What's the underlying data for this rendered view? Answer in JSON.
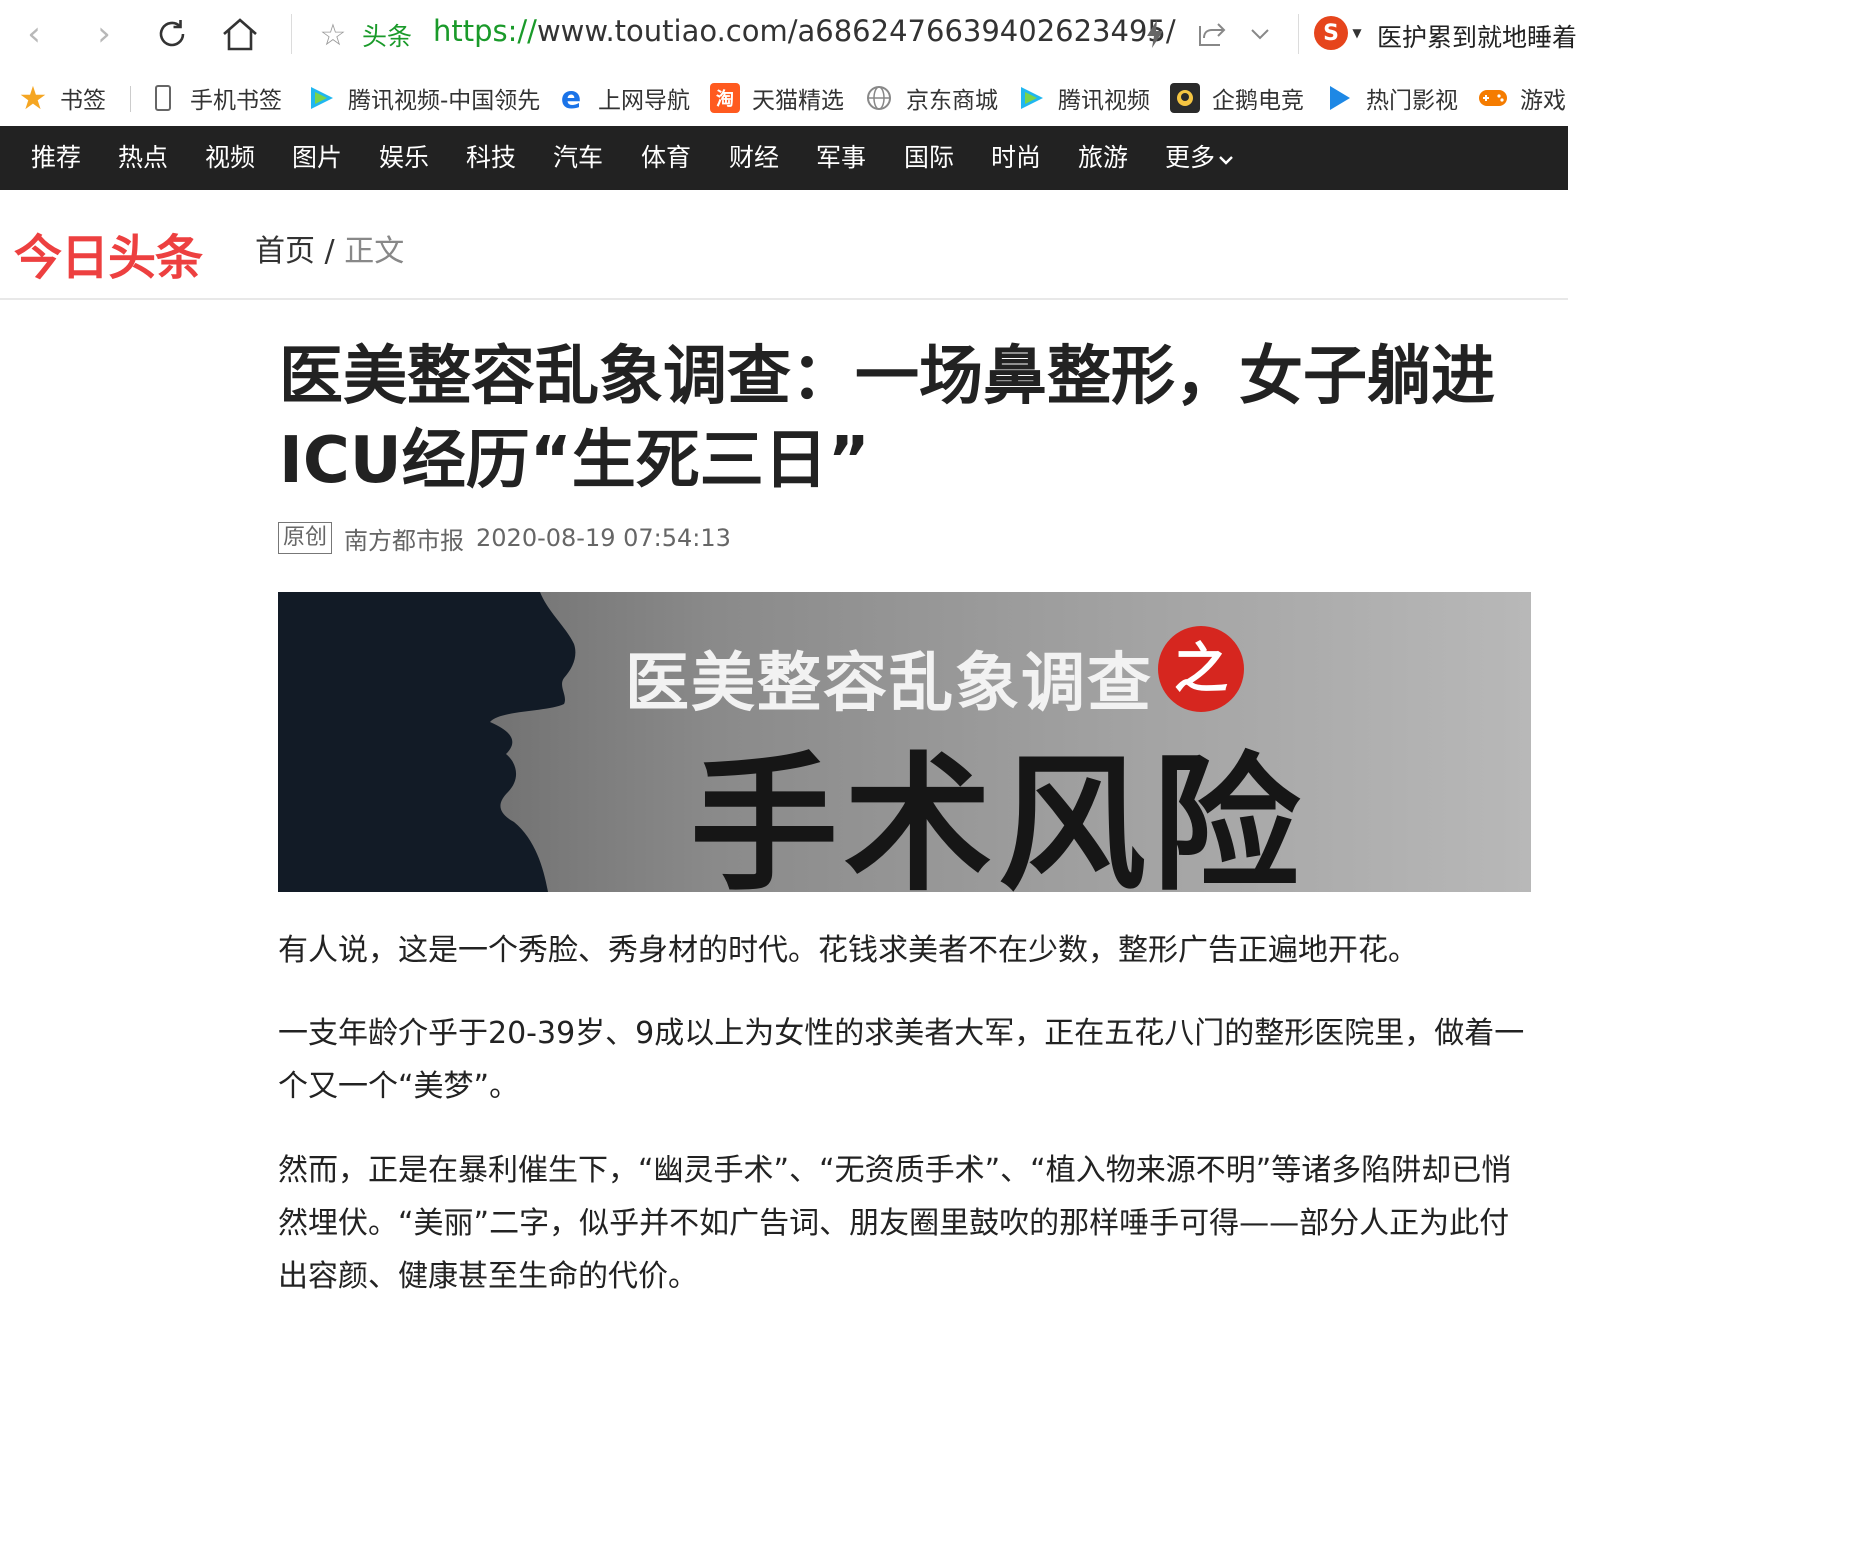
{
  "browser": {
    "site_name": "头条",
    "url_scheme": "https://",
    "url_rest": "www.toutiao.com/a6862476639402623495/",
    "search_engine_icon": "S",
    "search_text": "医护累到就地睡着"
  },
  "bookmarks": [
    {
      "label": "书签",
      "icon": "star-icon",
      "color": "#f5a623"
    },
    {
      "label": "手机书签",
      "icon": "phone-icon",
      "color": "#666666"
    },
    {
      "label": "腾讯视频-中国领先",
      "icon": "tencent-video-icon",
      "color": "#20b7f0"
    },
    {
      "label": "上网导航",
      "icon": "ie-icon",
      "color": "#1a73e8"
    },
    {
      "label": "天猫精选",
      "icon": "tmall-icon",
      "icon_text": "淘",
      "color": "#ff5a1f"
    },
    {
      "label": "京东商城",
      "icon": "globe-icon",
      "color": "#888888"
    },
    {
      "label": "腾讯视频",
      "icon": "tencent-video-icon",
      "color": "#20b7f0"
    },
    {
      "label": "企鹅电竞",
      "icon": "penguin-esports-icon",
      "color": "#2a2a2a"
    },
    {
      "label": "热门影视",
      "icon": "play-icon",
      "color": "#1e88e5"
    },
    {
      "label": "游戏",
      "icon": "gamepad-icon",
      "color": "#f57c00"
    }
  ],
  "channels": [
    "推荐",
    "热点",
    "视频",
    "图片",
    "娱乐",
    "科技",
    "汽车",
    "体育",
    "财经",
    "军事",
    "国际",
    "时尚",
    "旅游"
  ],
  "channel_more": "更多",
  "header": {
    "logo": "今日头条",
    "breadcrumb_home": "首页",
    "breadcrumb_sep": "/",
    "breadcrumb_current": "正文"
  },
  "article": {
    "title": "医美整容乱象调查：一场鼻整形，女子躺进ICU经历“生死三日”",
    "badge": "原创",
    "source": "南方都市报",
    "time": "2020-08-19 07:54:13",
    "banner_line1": "医美整容乱象调查",
    "banner_badge": "之",
    "banner_line2": "手术风险",
    "paragraphs": [
      "有人说，这是一个秀脸、秀身材的时代。花钱求美者不在少数，整形广告正遍地开花。",
      "一支年龄介乎于20-39岁、9成以上为女性的求美者大军，正在五花八门的整形医院里，做着一个又一个“美梦”。",
      "然而，正是在暴利催生下，“幽灵手术”、“无资质手术”、“植入物来源不明”等诸多陷阱却已悄然埋伏。“美丽”二字，似乎并不如广告词、朋友圈里鼓吹的那样唾手可得——部分人正为此付出容颜、健康甚至生命的代价。"
    ]
  },
  "colors": {
    "nav_bg": "#222222",
    "logo_red": "#ed4040",
    "url_green": "#1a9a2a"
  }
}
